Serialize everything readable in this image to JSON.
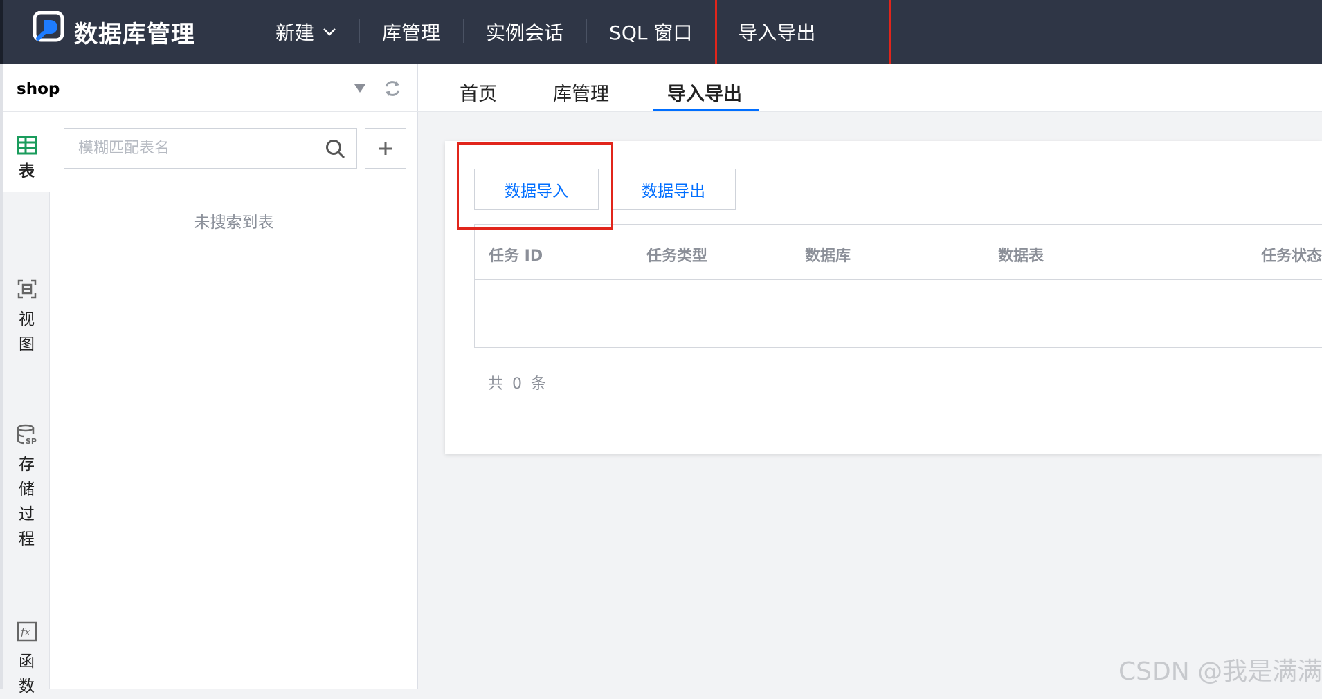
{
  "header": {
    "brand": "数据库管理",
    "nav": [
      {
        "label": "新建",
        "has_dropdown": true
      },
      {
        "label": "库管理"
      },
      {
        "label": "实例会话"
      },
      {
        "label": "SQL 窗口"
      },
      {
        "label": "导入导出",
        "highlighted": true
      }
    ]
  },
  "sidebar": {
    "database": "shop",
    "rail": [
      {
        "label": "表",
        "icon": "table-icon",
        "active": true
      },
      {
        "label": "视图",
        "icon": "view-icon"
      },
      {
        "label": "存储过程",
        "icon": "stored-procedure-icon"
      },
      {
        "label": "函数",
        "icon": "function-icon"
      }
    ],
    "search_placeholder": "模糊匹配表名",
    "empty_text": "未搜索到表"
  },
  "tabs": [
    {
      "label": "首页"
    },
    {
      "label": "库管理"
    },
    {
      "label": "导入导出",
      "active": true
    }
  ],
  "panel": {
    "import_button": "数据导入",
    "export_button": "数据导出",
    "columns": [
      "任务 ID",
      "任务类型",
      "数据库",
      "数据表",
      "任务状态"
    ],
    "rows": [],
    "total_prefix": "共",
    "total_count": "0",
    "total_suffix": "条"
  },
  "watermark": "CSDN @我是满满",
  "colors": {
    "topbar": "#2f3646",
    "accent": "#006eff",
    "highlight": "#e1251b",
    "rail_active": "#1a9c5c"
  }
}
